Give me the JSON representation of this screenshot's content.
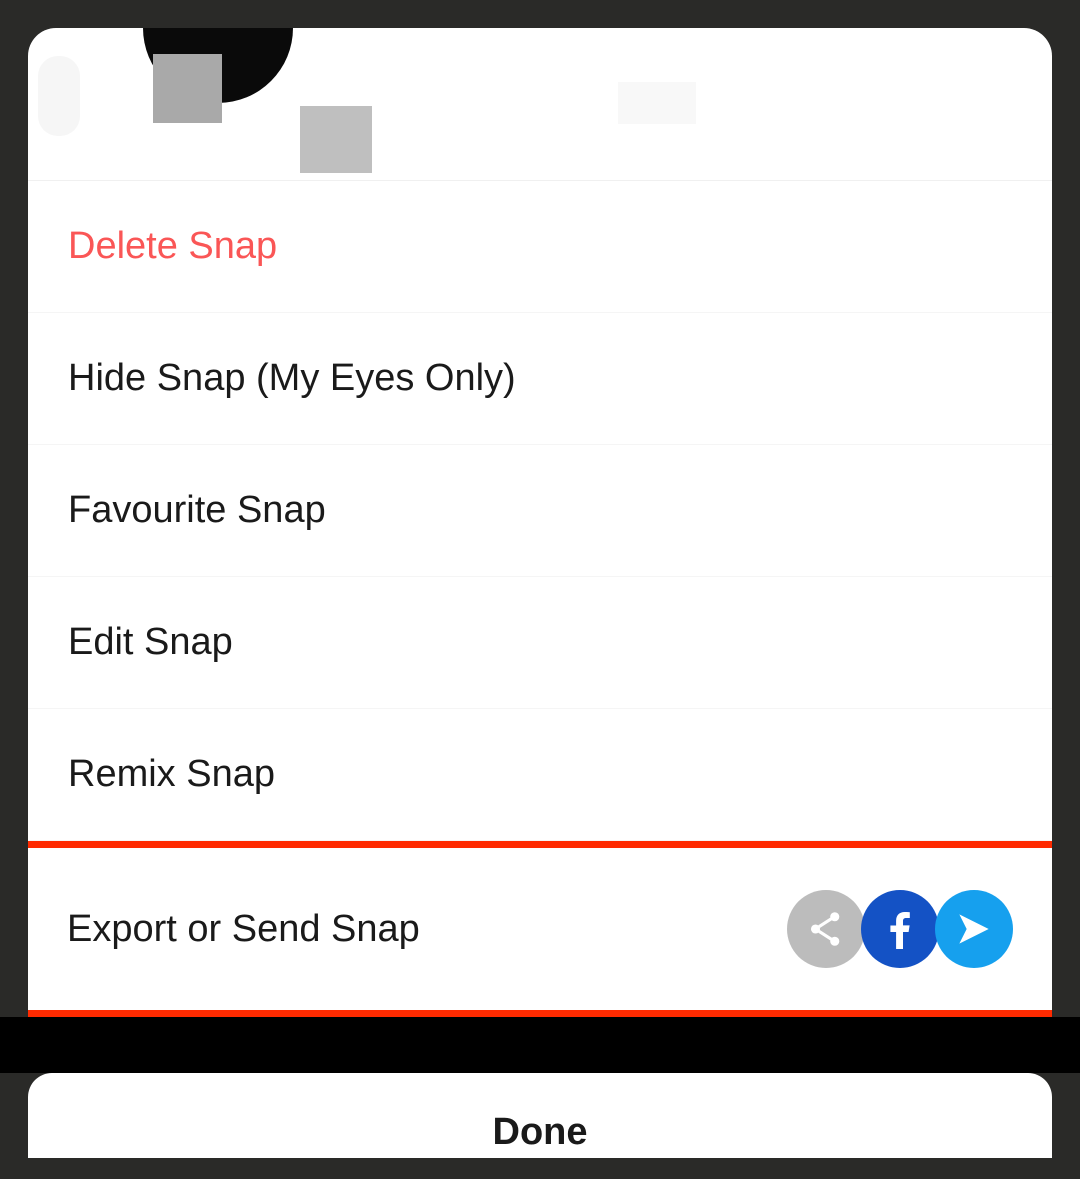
{
  "menu": {
    "items": [
      {
        "label": "Delete Snap",
        "destructive": true
      },
      {
        "label": "Hide Snap (My Eyes Only)"
      },
      {
        "label": "Favourite Snap"
      },
      {
        "label": "Edit Snap"
      },
      {
        "label": "Remix Snap"
      },
      {
        "label": "Export or Send Snap",
        "highlighted": true
      }
    ]
  },
  "footer": {
    "done_label": "Done"
  },
  "icons": {
    "share": "share-icon",
    "facebook": "facebook-icon",
    "send": "send-icon"
  }
}
